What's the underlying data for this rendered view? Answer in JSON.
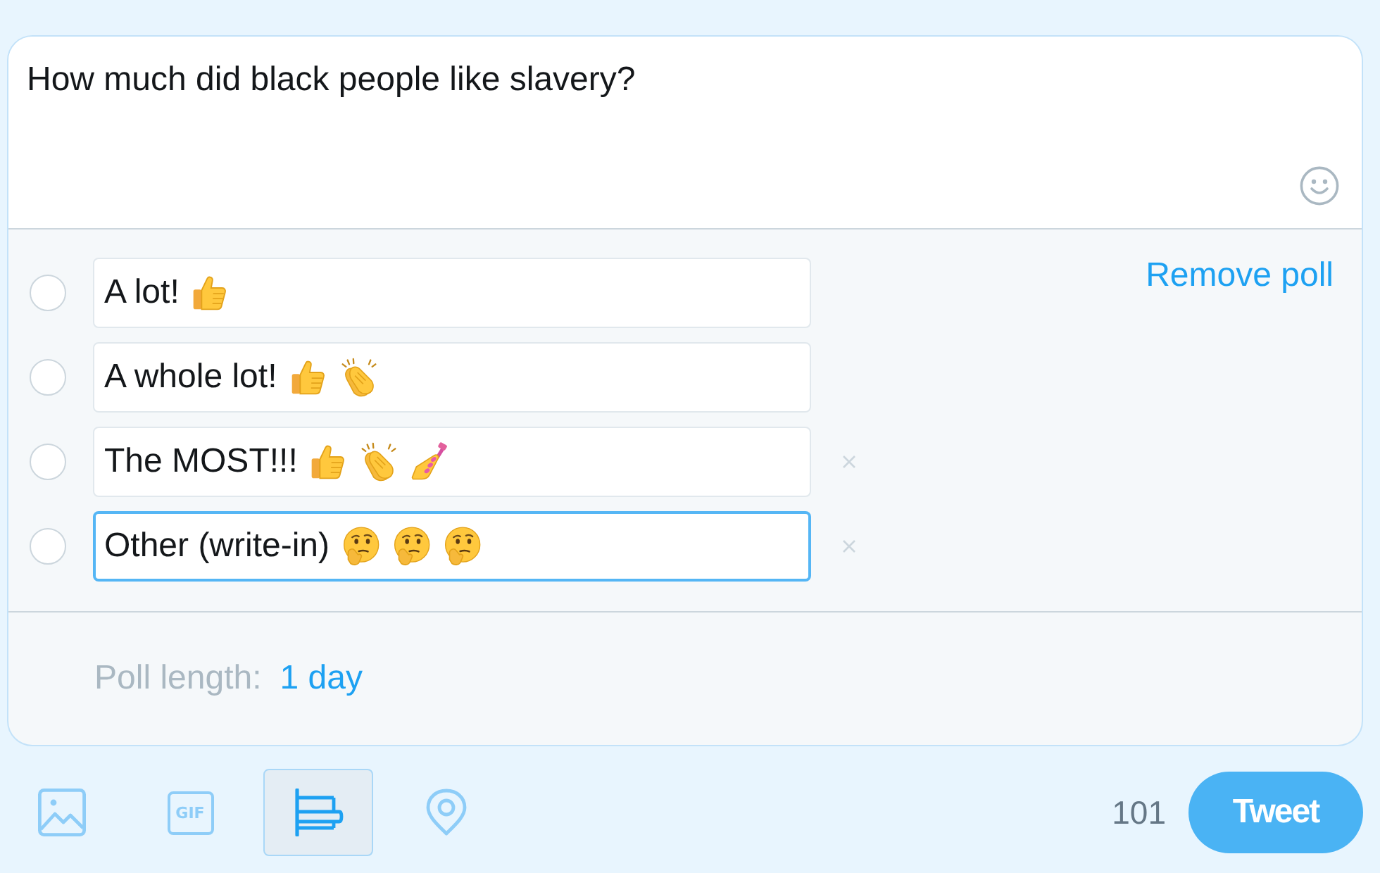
{
  "composer": {
    "text": "How much did black people like slavery?"
  },
  "poll": {
    "remove_label": "Remove poll",
    "choices": [
      {
        "text": "A lot!",
        "emoji": [
          {
            "kind": "thumbs_up"
          }
        ],
        "removable": false,
        "focused": false
      },
      {
        "text": "A whole lot!",
        "emoji": [
          {
            "kind": "thumbs_up"
          },
          {
            "kind": "clapping_hands"
          }
        ],
        "removable": false,
        "focused": false
      },
      {
        "text": "The MOST!!!",
        "emoji": [
          {
            "kind": "thumbs_up"
          },
          {
            "kind": "clapping_hands"
          },
          {
            "kind": "nail_polish"
          }
        ],
        "removable": true,
        "focused": false
      },
      {
        "text": "Other (write-in)",
        "emoji": [
          {
            "kind": "thinking_face"
          },
          {
            "kind": "thinking_face"
          },
          {
            "kind": "thinking_face"
          }
        ],
        "removable": true,
        "focused": true
      }
    ],
    "length_label": "Poll length:",
    "length_value": "1 day"
  },
  "toolbar": {
    "tools": [
      {
        "kind": "image",
        "selected": false
      },
      {
        "kind": "gif",
        "label": "GIF",
        "selected": false
      },
      {
        "kind": "poll",
        "selected": true
      },
      {
        "kind": "location",
        "selected": false
      }
    ],
    "counter": "101",
    "tweet_label": "Tweet"
  }
}
